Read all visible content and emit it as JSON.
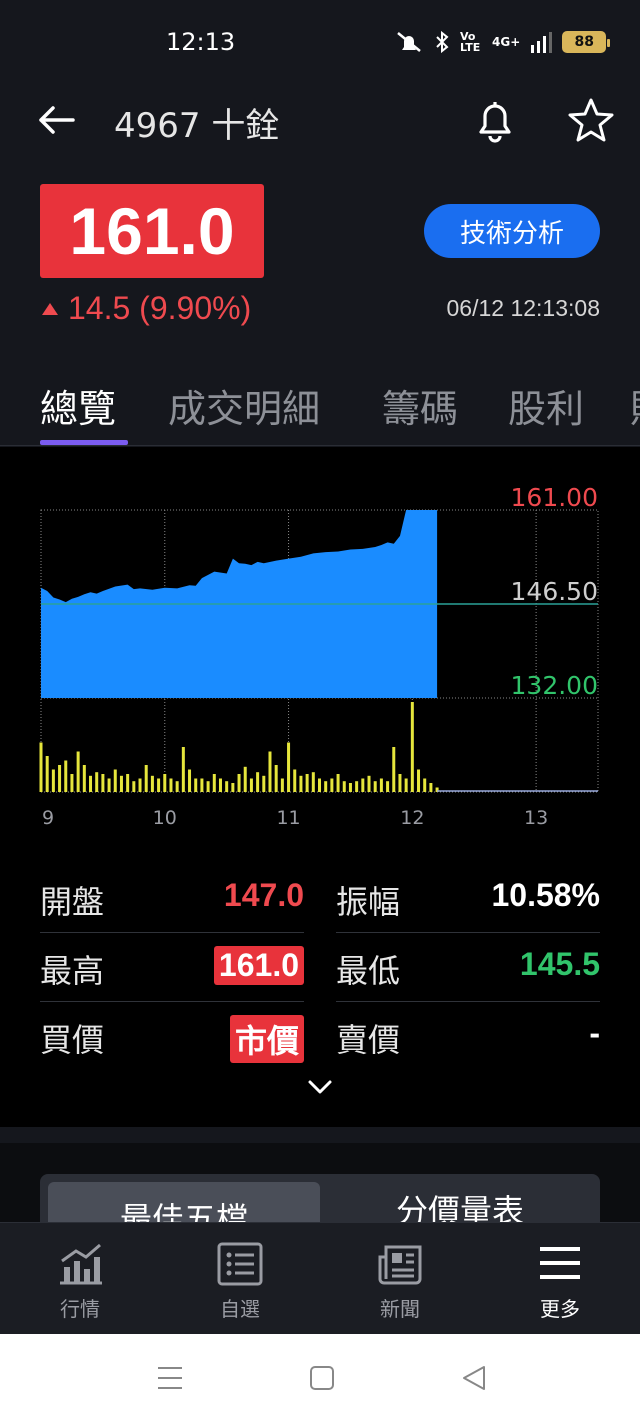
{
  "status_bar": {
    "time": "12:13",
    "network": "4G+",
    "volte": "Vo LTE",
    "battery": "88"
  },
  "header": {
    "title": "4967 十銓",
    "price": "161.0",
    "change": "14.5 (9.90%)",
    "tech_button": "技術分析",
    "timestamp": "06/12 12:13:08"
  },
  "tabs": [
    {
      "label": "總覽",
      "active": true
    },
    {
      "label": "成交明細",
      "active": false
    },
    {
      "label": "籌碼",
      "active": false
    },
    {
      "label": "股利",
      "active": false
    },
    {
      "label": "財",
      "active": false
    }
  ],
  "chart_data": {
    "type": "area",
    "title": "",
    "price_labels": {
      "high": "161.00",
      "ref": "146.50",
      "low": "132.00"
    },
    "ylim": [
      132.0,
      161.0
    ],
    "reference": 146.5,
    "x_ticks": [
      "9",
      "10",
      "11",
      "12",
      "13"
    ],
    "xlim": [
      9.0,
      13.5
    ],
    "price_series": {
      "x": [
        9.0,
        9.05,
        9.1,
        9.15,
        9.2,
        9.25,
        9.3,
        9.35,
        9.4,
        9.45,
        9.5,
        9.6,
        9.7,
        9.75,
        9.8,
        9.9,
        10.0,
        10.1,
        10.2,
        10.25,
        10.3,
        10.4,
        10.5,
        10.55,
        10.6,
        10.65,
        10.7,
        10.75,
        10.8,
        10.9,
        11.0,
        11.1,
        11.2,
        11.3,
        11.4,
        11.5,
        11.6,
        11.7,
        11.75,
        11.8,
        11.85,
        11.9,
        11.95,
        12.0,
        12.1,
        12.2
      ],
      "y": [
        149.0,
        148.5,
        147.5,
        147.2,
        146.8,
        147.3,
        147.6,
        148.0,
        148.3,
        148.1,
        148.5,
        149.2,
        149.5,
        148.8,
        148.9,
        148.7,
        149.0,
        148.9,
        149.4,
        149.3,
        150.5,
        151.5,
        151.2,
        153.5,
        152.8,
        152.7,
        152.5,
        153.0,
        152.8,
        153.2,
        153.5,
        153.8,
        154.3,
        154.5,
        154.6,
        154.9,
        155.0,
        155.3,
        155.6,
        156.0,
        155.8,
        157.0,
        161.0,
        161.0,
        161.0,
        161.0
      ]
    },
    "volume_series": {
      "x": [
        9.0,
        9.05,
        9.1,
        9.15,
        9.2,
        9.25,
        9.3,
        9.35,
        9.4,
        9.45,
        9.5,
        9.55,
        9.6,
        9.65,
        9.7,
        9.75,
        9.8,
        9.85,
        9.9,
        9.95,
        10.0,
        10.05,
        10.1,
        10.15,
        10.2,
        10.25,
        10.3,
        10.35,
        10.4,
        10.45,
        10.5,
        10.55,
        10.6,
        10.65,
        10.7,
        10.75,
        10.8,
        10.85,
        10.9,
        10.95,
        11.0,
        11.05,
        11.1,
        11.15,
        11.2,
        11.25,
        11.3,
        11.35,
        11.4,
        11.45,
        11.5,
        11.55,
        11.6,
        11.65,
        11.7,
        11.75,
        11.8,
        11.85,
        11.9,
        11.95,
        12.0,
        12.05,
        12.1,
        12.15,
        12.2
      ],
      "v": [
        55,
        40,
        25,
        30,
        35,
        20,
        45,
        30,
        18,
        22,
        20,
        15,
        25,
        18,
        20,
        12,
        15,
        30,
        18,
        15,
        20,
        15,
        12,
        50,
        25,
        15,
        15,
        12,
        20,
        15,
        12,
        10,
        20,
        28,
        15,
        22,
        18,
        45,
        30,
        15,
        55,
        25,
        18,
        20,
        22,
        15,
        12,
        15,
        20,
        12,
        10,
        12,
        15,
        18,
        12,
        15,
        12,
        50,
        20,
        15,
        100,
        25,
        15,
        10,
        5
      ]
    }
  },
  "stats": {
    "open_label": "開盤",
    "open_value": "147.0",
    "amp_label": "振幅",
    "amp_value": "10.58%",
    "high_label": "最高",
    "high_value": "161.0",
    "low_label": "最低",
    "low_value": "145.5",
    "bid_label": "買價",
    "bid_value": "市價",
    "ask_label": "賣價",
    "ask_value": "-"
  },
  "segment": {
    "left": "最佳五檔",
    "right": "分價量表"
  },
  "bottom_nav": [
    {
      "label": "行情",
      "icon": "bar-chart-icon"
    },
    {
      "label": "自選",
      "icon": "list-icon"
    },
    {
      "label": "新聞",
      "icon": "news-icon"
    },
    {
      "label": "更多",
      "icon": "menu-icon"
    }
  ],
  "colors": {
    "up": "#ef4a4f",
    "down": "#31c46b",
    "area": "#1a8cff",
    "volume": "#e6e63c",
    "accent": "#1a6ef0"
  }
}
